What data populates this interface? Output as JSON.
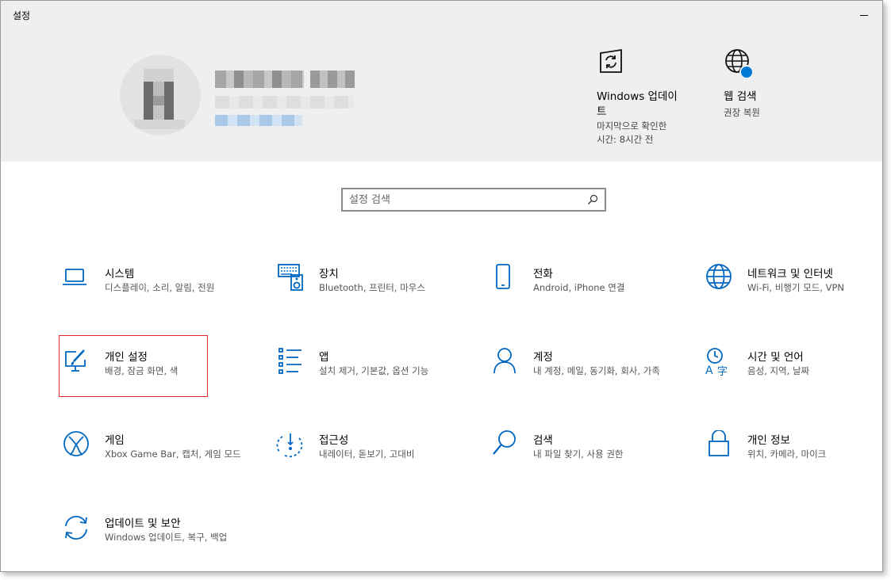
{
  "window": {
    "title": "설정"
  },
  "header": {
    "windows_update": {
      "title": "Windows 업데이트",
      "status_line1": "마지막으로 확인한",
      "status_line2": "시간: 8시간 전"
    },
    "web_search": {
      "title": "웹 검색",
      "subtitle": "권장 복원"
    }
  },
  "search": {
    "placeholder": "설정 검색"
  },
  "categories": [
    {
      "title": "시스템",
      "subtitle": "디스플레이, 소리, 알림, 전원"
    },
    {
      "title": "장치",
      "subtitle": "Bluetooth, 프린터, 마우스"
    },
    {
      "title": "전화",
      "subtitle": "Android, iPhone 연결"
    },
    {
      "title": "네트워크 및 인터넷",
      "subtitle": "Wi-Fi, 비행기 모드, VPN"
    },
    {
      "title": "개인 설정",
      "subtitle": "배경, 잠금 화면, 색"
    },
    {
      "title": "앱",
      "subtitle": "설치 제거, 기본값, 옵션 기능"
    },
    {
      "title": "계정",
      "subtitle": "내 계정, 메일, 동기화, 회사, 가족"
    },
    {
      "title": "시간 및 언어",
      "subtitle": "음성, 지역, 날짜"
    },
    {
      "title": "게임",
      "subtitle": "Xbox Game Bar, 캡처, 게임 모드"
    },
    {
      "title": "접근성",
      "subtitle": "내레이터, 돋보기, 고대비"
    },
    {
      "title": "검색",
      "subtitle": "내 파일 찾기, 사용 권한"
    },
    {
      "title": "개인 정보",
      "subtitle": "위치, 카메라, 마이크"
    },
    {
      "title": "업데이트 및 보안",
      "subtitle": "Windows 업데이트, 복구, 백업"
    }
  ],
  "colors": {
    "accent": "#0067c0",
    "header_bg": "#efefef",
    "highlight": "#e02626",
    "badge": "#0078d4"
  }
}
